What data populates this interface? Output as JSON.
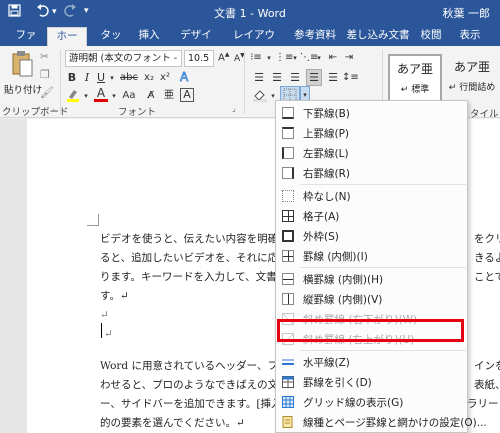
{
  "titlebar": {
    "title": "文書 1 - Word",
    "user": "秋葉 一郎",
    "save_icon": "save-icon",
    "undo_icon": "undo-icon",
    "redo_icon": "redo-icon"
  },
  "tabs": [
    "ファイル",
    "ホーム",
    "タッチ",
    "挿入",
    "デザイン",
    "レイアウト",
    "参考資料",
    "差し込み文書",
    "校閲",
    "表示"
  ],
  "ribbon": {
    "paste_label": "貼り付け",
    "clipboard_label": "クリップボード",
    "font_label": "フォント",
    "style_label": "タイル",
    "font_name": "游明朝 (本文のフォント - 日",
    "font_size": "10.5",
    "bold": "B",
    "italic": "I",
    "underline": "U",
    "strike": "abc",
    "subscript": "x₂",
    "superscript": "x²",
    "font_color": "A",
    "highlight_icon": "highlight-icon",
    "styles": [
      {
        "big": "あア亜",
        "small": "↵ 標準"
      },
      {
        "big": "あア亜",
        "small": "↵ 行間詰め"
      }
    ]
  },
  "document": {
    "para1": [
      "ビデオを使うと、伝えたい内容を明確",
      "ると、追加したいビデオを、それに応",
      "ります。キーワードを入力して、文書",
      "す。↵"
    ],
    "para1_right": [
      "をクリッ",
      "きるよう",
      "ことでで"
    ],
    "empty1": "↵",
    "empty2": "↵",
    "para2": [
      "Word に用意されているヘッダー、フ",
      "わせると、プロのようなできばえの文",
      "ー、サイドバーを追加できます。[挿入] をクリックしてから、それぞれのギャラリー",
      "的の要素を選んでください。↵"
    ],
    "para2_right": [
      "インを組",
      "表紙、ペ"
    ]
  },
  "border_menu": {
    "items": [
      {
        "label": "下罫線(B)",
        "icon": "border-bottom-icon",
        "disabled": false
      },
      {
        "label": "上罫線(P)",
        "icon": "border-top-icon",
        "disabled": false
      },
      {
        "label": "左罫線(L)",
        "icon": "border-left-icon",
        "disabled": false
      },
      {
        "label": "右罫線(R)",
        "icon": "border-right-icon",
        "disabled": false
      },
      {
        "label": "枠なし(N)",
        "icon": "border-none-icon",
        "disabled": false
      },
      {
        "label": "格子(A)",
        "icon": "border-all-icon",
        "disabled": false
      },
      {
        "label": "外枠(S)",
        "icon": "border-outside-icon",
        "disabled": false
      },
      {
        "label": "罫線 (内側)(I)",
        "icon": "border-inside-icon",
        "disabled": false
      },
      {
        "label": "横罫線 (内側)(H)",
        "icon": "border-inside-horizontal-icon",
        "disabled": false
      },
      {
        "label": "縦罫線 (内側)(V)",
        "icon": "border-inside-vertical-icon",
        "disabled": false
      },
      {
        "label": "斜め罫線 (右下がり)(W)",
        "icon": "border-diagonal-down-icon",
        "disabled": true
      },
      {
        "label": "斜め罫線 (右上がり)(U)",
        "icon": "border-diagonal-up-icon",
        "disabled": true
      },
      {
        "label": "水平線(Z)",
        "icon": "horizontal-line-icon",
        "disabled": false
      },
      {
        "label": "罫線を引く(D)",
        "icon": "draw-table-icon",
        "disabled": false
      },
      {
        "label": "グリッド線の表示(G)",
        "icon": "view-gridlines-icon",
        "disabled": false
      },
      {
        "label": "線種とページ罫線と網かけの設定(O)...",
        "icon": "borders-shading-icon",
        "disabled": false
      }
    ]
  },
  "colors": {
    "brand": "#2b579a",
    "highlight_box": "#e60012"
  }
}
